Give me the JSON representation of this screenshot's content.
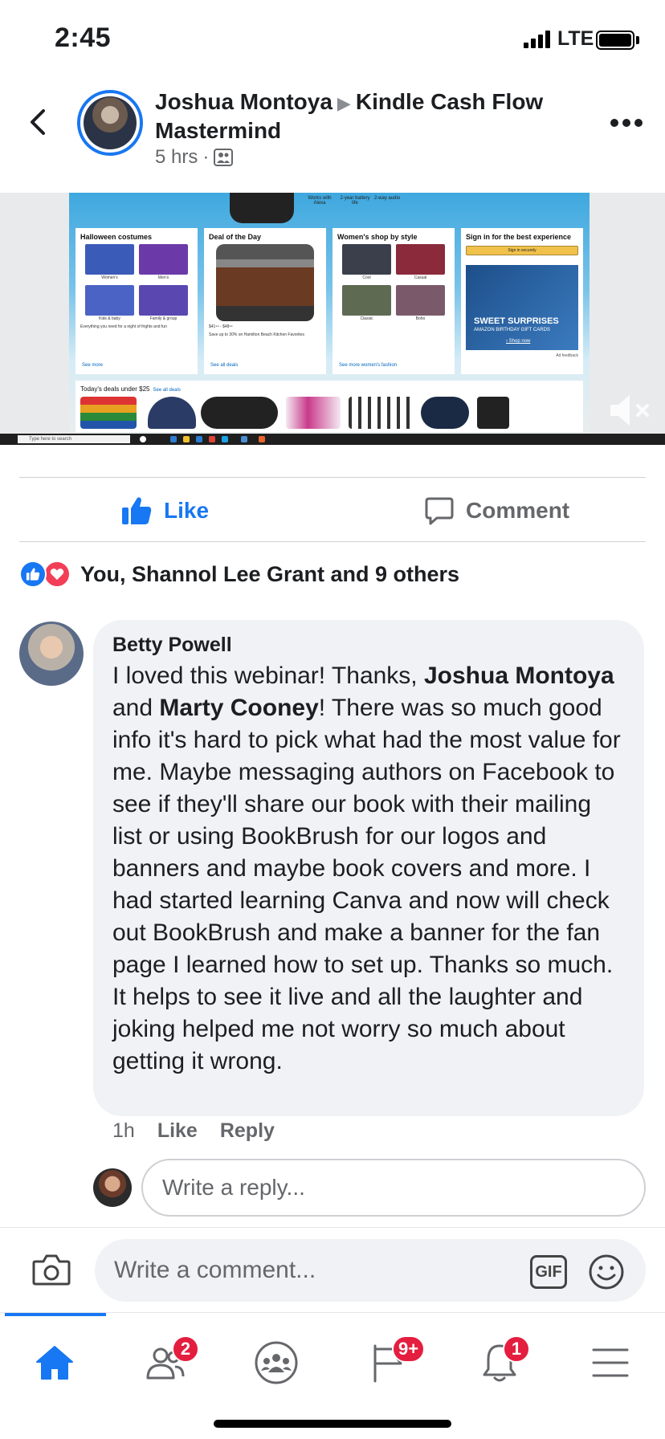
{
  "status_bar": {
    "time": "2:45",
    "network": "LTE",
    "battery_level": 1.0
  },
  "post": {
    "author": "Joshua Montoya",
    "group": "Kindle Cash Flow Mastermind",
    "time_ago": "5 hrs",
    "separator": "·"
  },
  "media": {
    "features": [
      "Works with Alexa",
      "2-year battery life",
      "2-way audio"
    ],
    "cards": {
      "halloween": {
        "title": "Halloween costumes",
        "captions": [
          "Women's",
          "Men's",
          "Kids & baby",
          "Family & group"
        ],
        "note": "Everything you need for a night of frights and fun",
        "link": "See more"
      },
      "deal": {
        "title": "Deal of the Day",
        "price": "$41⁹⁹ - $48⁹⁹",
        "note": "Save up to 30% on Hamilton Beach Kitchen Favorites",
        "link": "See all deals"
      },
      "women": {
        "title": "Women's shop by style",
        "captions": [
          "Cool",
          "Casual",
          "Classic",
          "Boho"
        ],
        "link": "See more women's fashion"
      },
      "signin": {
        "title": "Sign in for the best experience",
        "button": "Sign in securely",
        "promo_title": "SWEET SURPRISES",
        "promo_sub": "AMAZON BIRTHDAY GIFT CARDS",
        "promo_link": "› Shop now",
        "ad_feedback": "Ad feedback"
      }
    },
    "deals_strip": {
      "title": "Today's deals under $25",
      "link": "See all deals"
    },
    "taskbar_search": "Type here to search"
  },
  "actions": {
    "like": "Like",
    "comment": "Comment"
  },
  "reactions": {
    "summary": "You, Shannol Lee Grant and 9 others"
  },
  "comment": {
    "author": "Betty Powell",
    "text_1": "I loved this webinar!  Thanks, ",
    "mention_1": "Joshua Montoya",
    "text_2": " and ",
    "mention_2": "Marty Cooney",
    "text_3": "!  There was so much good info it's hard to pick what had the most value for me.  Maybe messaging authors on Facebook to see if they'll share our book with their mailing list or using BookBrush for our logos and banners and maybe book covers and more.  I had started learning Canva and now will check out BookBrush and make a banner for the fan page I learned how to set up.  Thanks so much.  It helps to see it  live and all the laughter and joking helped me not worry so much about getting it wrong.",
    "time": "1h",
    "like": "Like",
    "reply": "Reply"
  },
  "reply_placeholder": "Write a reply...",
  "composer": {
    "placeholder": "Write a comment...",
    "gif_label": "GIF"
  },
  "tab_bar": {
    "badges": {
      "friends": "2",
      "pages": "9+",
      "notifications": "1"
    }
  },
  "colors": {
    "accent": "#1877f2",
    "badge": "#e41e3f",
    "love": "#f33e58"
  },
  "icons": [
    "back-icon",
    "group-icon",
    "more-icon",
    "mute-icon",
    "like-thumb-icon",
    "comment-icon",
    "camera-icon",
    "gif-icon",
    "smile-icon",
    "home-icon",
    "friends-icon",
    "groups-icon",
    "pages-flag-icon",
    "bell-icon",
    "menu-icon"
  ]
}
